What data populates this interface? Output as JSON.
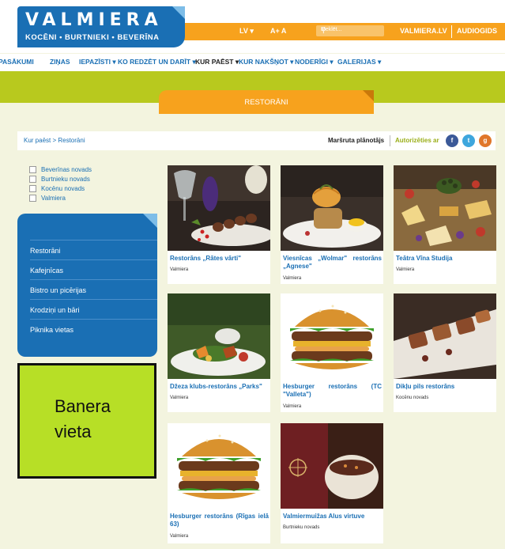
{
  "header": {
    "logo_title": "VALMIERA",
    "logo_subtitle": "KOCĒNI • BURTNIEKI • BEVERĪNA",
    "lang": "LV",
    "lang_caret": "▾",
    "font_size": "A+ A",
    "search_placeholder": "Meklēt...",
    "link_valmiera": "VALMIERA.LV",
    "link_audiogids": "AUDIOGIDS"
  },
  "nav": {
    "items": [
      "PASĀKUMI",
      "ZIŅAS",
      "IEPAZĪSTI ▾",
      "KO REDZĒT UN DARĪT ▾",
      "KUR PAĒST ▾",
      "KUR NAKŠŅOT ▾",
      "NODERĪGI ▾",
      "GALERIJAS ▾"
    ]
  },
  "section_tab": "RESTORĀNI",
  "breadcrumb": "Kur paēst  >  Restorāni",
  "route_planner": "Maršruta plānotājs",
  "login": "Autorizēties ar",
  "social": [
    "f",
    "t",
    "g"
  ],
  "colors": {
    "facebook": "#3b5998",
    "twitter": "#3ea6dd",
    "google": "#e0762a"
  },
  "filters": [
    "Beverīnas novads",
    "Burtnieku novads",
    "Kocēnu novads",
    "Valmiera"
  ],
  "menu": [
    "Restorāni",
    "Kafejnīcas",
    "Bistro un picērijas",
    "Krodziņi un bāri",
    "Piknika vietas"
  ],
  "banner": "Banera vieta",
  "cards": [
    {
      "title": "Restorāns „Rātes vārti\"",
      "location": "Valmiera"
    },
    {
      "title": "Viesnīcas „Wolmar\" restorāns „Agnese\"",
      "location": "Valmiera"
    },
    {
      "title": "Teātra Vīna Studija",
      "location": "Valmiera"
    },
    {
      "title": "Džeza klubs-restorāns „Parks\"",
      "location": "Valmiera"
    },
    {
      "title": "Hesburger restorāns (TC \"Valleta\")",
      "location": "Valmiera"
    },
    {
      "title": "Dikļu pils restorāns",
      "location": "Kocēnu novads"
    },
    {
      "title": "Hesburger restorāns (Rīgas ielā 63)",
      "location": "Valmiera"
    },
    {
      "title": "Valmiermuižas Alus virtuve",
      "location": "Burtnieku novads"
    }
  ]
}
